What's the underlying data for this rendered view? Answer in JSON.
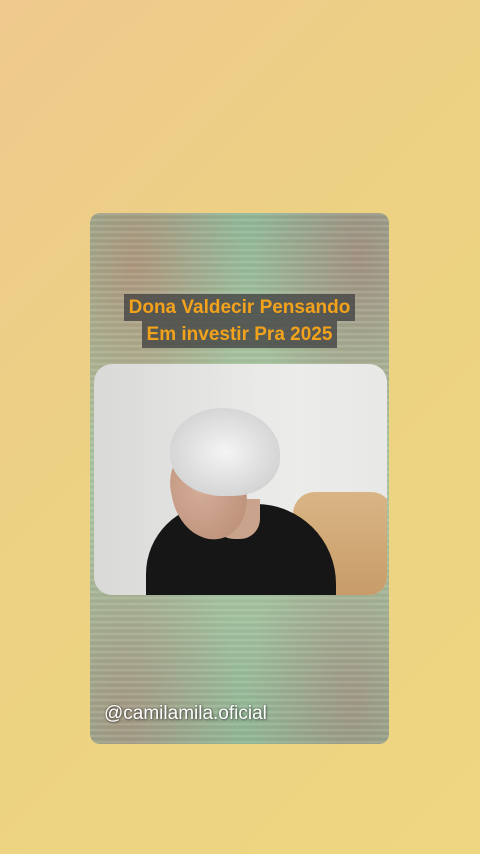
{
  "card": {
    "title_line1": "Dona Valdecir Pensando",
    "title_line2": "Em investir Pra 2025",
    "handle": "@camilamila.oficial"
  },
  "colors": {
    "background": "#ecd282",
    "title_text": "#f2a21b",
    "title_bg": "#464646",
    "card_green": "#a9c29d"
  }
}
